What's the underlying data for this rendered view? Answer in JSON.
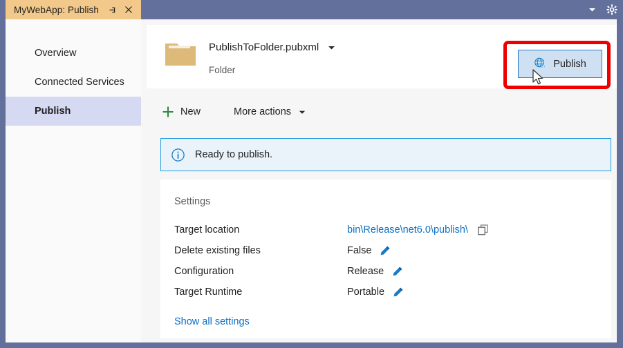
{
  "titlebar": {
    "tab_label": "MyWebApp: Publish",
    "pin_icon": "pin-icon",
    "close_icon": "close-icon",
    "chevron_icon": "chevron-down-icon",
    "gear_icon": "gear-icon",
    "background_color": "#63709c",
    "tab_color": "#f2c98a"
  },
  "sidebar": {
    "items": [
      {
        "label": "Overview",
        "selected": false
      },
      {
        "label": "Connected Services",
        "selected": false
      },
      {
        "label": "Publish",
        "selected": true
      }
    ],
    "selected_color": "#d5d9f2"
  },
  "header": {
    "folder_icon": "folder-icon",
    "profile_name": "PublishToFolder.pubxml",
    "profile_caret_icon": "chevron-down-icon",
    "profile_type": "Folder",
    "publish_button_label": "Publish",
    "publish_button_icon": "globe-publish-icon",
    "publish_button_color": "#cfe0f2",
    "annotation_color": "#ee0000"
  },
  "toolbar": {
    "new_label": "New",
    "new_icon": "plus-icon",
    "new_icon_color": "#2e8b3d",
    "more_actions_label": "More actions",
    "more_actions_caret_icon": "chevron-down-icon"
  },
  "banner": {
    "icon": "info-icon",
    "text": "Ready to publish.",
    "background_color": "#eaf3fa",
    "border_color": "#1e9ae0"
  },
  "settings": {
    "title": "Settings",
    "rows": [
      {
        "label": "Target location",
        "value": "bin\\Release\\net6.0\\publish\\",
        "value_kind": "link",
        "action_icon": "copy-icon"
      },
      {
        "label": "Delete existing files",
        "value": "False",
        "value_kind": "text",
        "action_icon": "pencil-icon"
      },
      {
        "label": "Configuration",
        "value": "Release",
        "value_kind": "text",
        "action_icon": "pencil-icon"
      },
      {
        "label": "Target Runtime",
        "value": "Portable",
        "value_kind": "text",
        "action_icon": "pencil-icon"
      }
    ],
    "show_all_label": "Show all settings",
    "link_color": "#0b6ec4"
  }
}
